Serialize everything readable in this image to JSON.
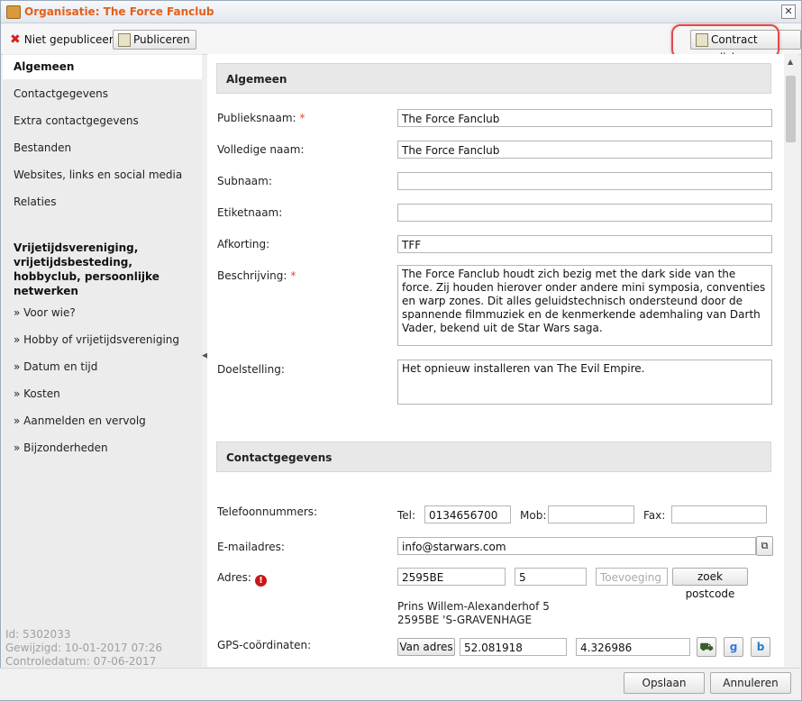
{
  "window": {
    "title": "Organisatie: The Force Fanclub",
    "close_glyph": "✕"
  },
  "toolbar": {
    "unpublished_label": "Niet gepubliceerd",
    "publish_label": "Publiceren",
    "contract_label": "Contract wijzigen"
  },
  "sidebar": {
    "items": [
      "Algemeen",
      "Contactgegevens",
      "Extra contactgegevens",
      "Bestanden",
      "Websites, links en social media",
      "Relaties"
    ],
    "group_heading": "Vrijetijdsvereniging, vrijetijdsbesteding, hobbyclub, persoonlijke netwerken",
    "sub_items": [
      "» Voor wie?",
      "» Hobby of vrijetijdsvereniging",
      "» Datum en tijd",
      "» Kosten",
      "» Aanmelden en vervolg",
      "» Bijzonderheden"
    ],
    "meta": {
      "id": "Id: 5302033",
      "modified": "Gewijzigd: 10-01-2017 07:26",
      "checked": "Controledatum: 07-06-2017"
    }
  },
  "algemeen": {
    "heading": "Algemeen",
    "publieksnaam_label": "Publieksnaam:",
    "publieksnaam_value": "The Force Fanclub",
    "volledige_naam_label": "Volledige naam:",
    "volledige_naam_value": "The Force Fanclub",
    "subnaam_label": "Subnaam:",
    "subnaam_value": "",
    "etiketnaam_label": "Etiketnaam:",
    "etiketnaam_value": "",
    "afkorting_label": "Afkorting:",
    "afkorting_value": "TFF",
    "beschrijving_label": "Beschrijving:",
    "beschrijving_value": "The Force Fanclub houdt zich bezig met the dark side van the force. Zij houden hierover onder andere mini symposia, conventies en warp zones. Dit alles geluidstechnisch ondersteund door de spannende filmmuziek en de kenmerkende ademhaling van Darth Vader, bekend uit de Star Wars saga.",
    "doelstelling_label": "Doelstelling:",
    "doelstelling_value": "Het opnieuw installeren van The Evil Empire.",
    "required_mark": "*"
  },
  "contact": {
    "heading": "Contactgegevens",
    "phones_label": "Telefoonnummers:",
    "tel_label": "Tel:",
    "tel_value": "0134656700",
    "mob_label": "Mob:",
    "mob_value": "",
    "fax_label": "Fax:",
    "fax_value": "",
    "email_label": "E-mailadres:",
    "email_value": "info@starwars.com",
    "address_label": "Adres:",
    "postcode_value": "2595BE",
    "housenumber_value": "5",
    "addition_placeholder": "Toevoeging",
    "lookup_label": "zoek postcode",
    "address_line1": "Prins Willem-Alexanderhof 5",
    "address_line2": "2595BE 'S-GRAVENHAGE",
    "gps_label": "GPS-coördinaten:",
    "from_address_label": "Van adres",
    "lat_value": "52.081918",
    "lon_value": "4.326986"
  },
  "footer": {
    "save_label": "Opslaan",
    "cancel_label": "Annuleren"
  }
}
